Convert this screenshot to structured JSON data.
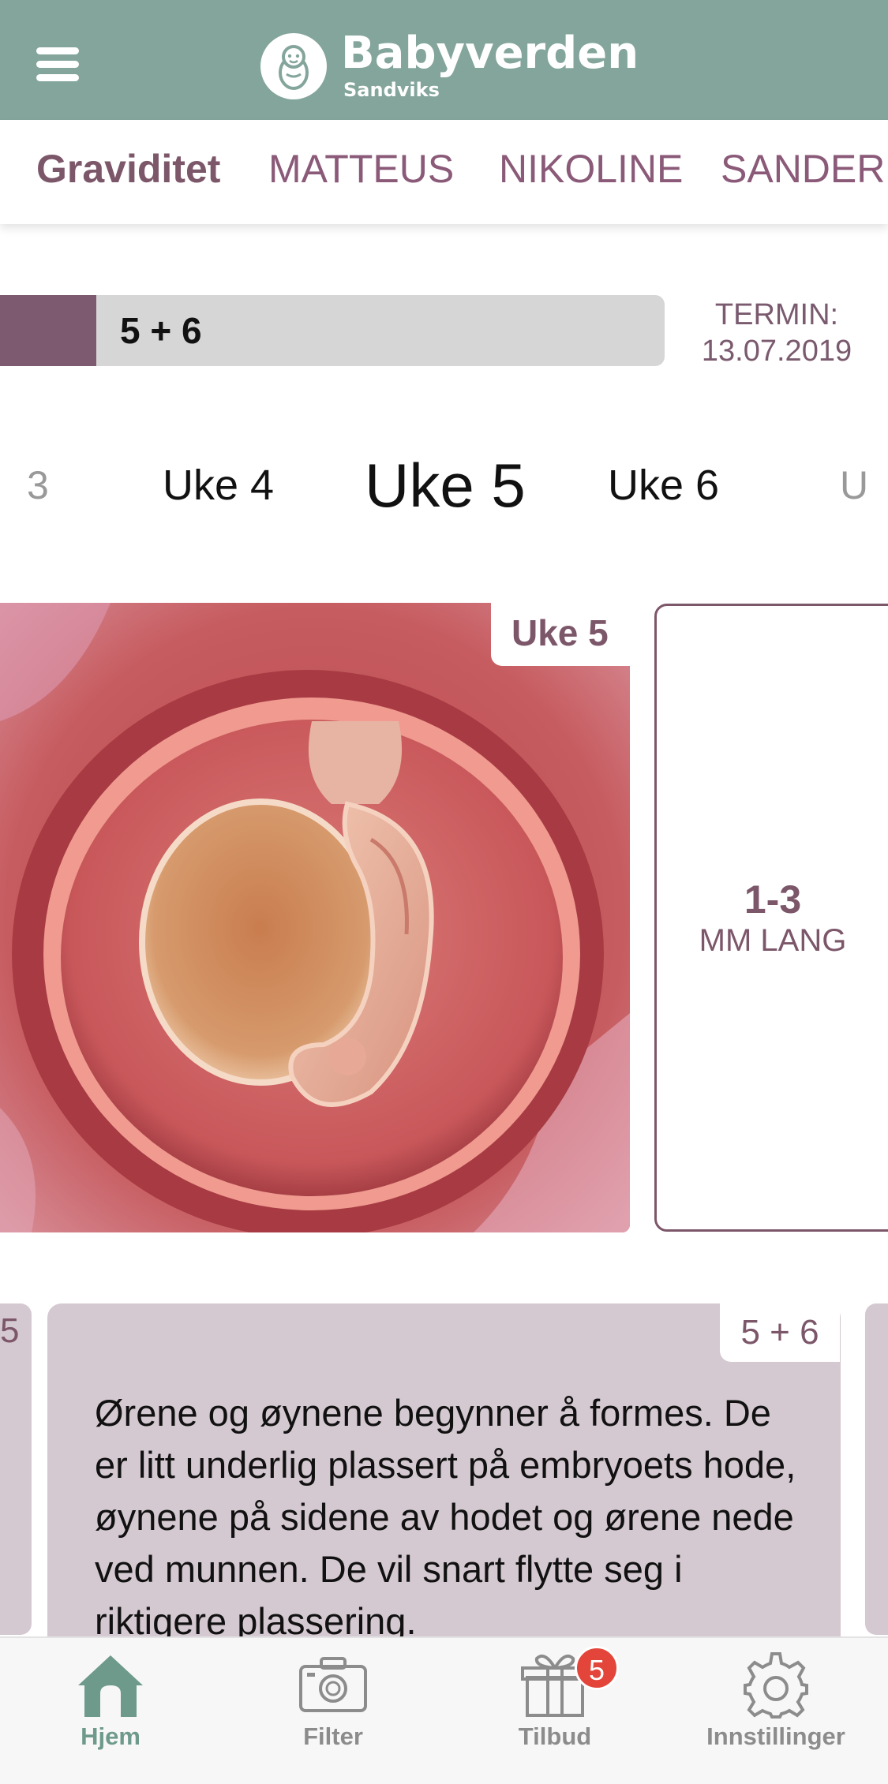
{
  "header": {
    "brand": "Babyverden",
    "subtitle": "Sandviks",
    "accent_color": "#83a59b"
  },
  "tabs": [
    {
      "label": "Graviditet",
      "active": true
    },
    {
      "label": "MATTEUS",
      "active": false
    },
    {
      "label": "NIKOLINE",
      "active": false
    },
    {
      "label": "SANDER",
      "active": false
    }
  ],
  "progress": {
    "label": "5 + 6",
    "fraction": 0.145,
    "termin_label": "TERMIN:",
    "termin_date": "13.07.2019"
  },
  "weeks": {
    "prev2": "3",
    "prev": "Uke 4",
    "current": "Uke 5",
    "next": "Uke 6",
    "next2": "U"
  },
  "image_card": {
    "badge": "Uke 5"
  },
  "size_card": {
    "value": "1-3",
    "unit": "MM LANG"
  },
  "fact_card": {
    "badge": "5 + 6",
    "text": "Ørene og øynene begynner å formes. De er litt underlig plassert på embryoets hode, øynene på sidene av hodet og ørene nede ved munnen. De vil snart flytte seg i riktigere plassering.",
    "left_peek": "5"
  },
  "bottom_nav": [
    {
      "label": "Hjem",
      "icon": "home-icon",
      "active": true
    },
    {
      "label": "Filter",
      "icon": "camera-icon",
      "active": false
    },
    {
      "label": "Tilbud",
      "icon": "gift-icon",
      "active": false,
      "badge": "5"
    },
    {
      "label": "Innstillinger",
      "icon": "gear-icon",
      "active": false
    }
  ]
}
